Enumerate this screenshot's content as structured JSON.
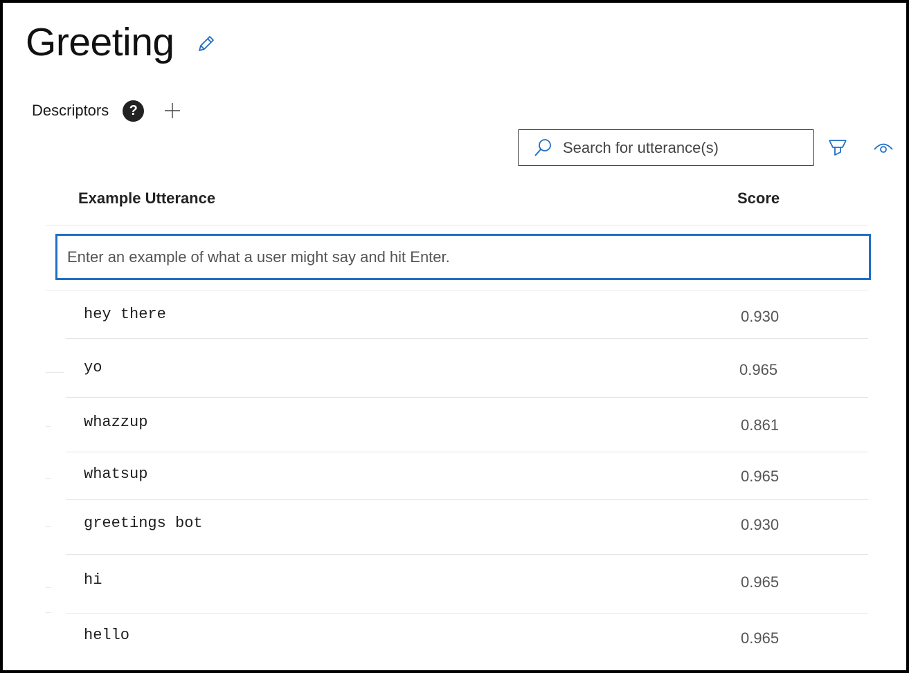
{
  "intent": {
    "title": "Greeting"
  },
  "descriptors": {
    "label": "Descriptors",
    "help_glyph": "?"
  },
  "search": {
    "placeholder": "Search for utterance(s)"
  },
  "table": {
    "columns": {
      "utterance": "Example Utterance",
      "score": "Score"
    },
    "entry_placeholder": "Enter an example of what a user might say and hit Enter.",
    "rows": [
      {
        "utterance": "hey there",
        "score": "0.930"
      },
      {
        "utterance": "yo",
        "score": "0.965"
      },
      {
        "utterance": "whazzup",
        "score": "0.861"
      },
      {
        "utterance": "whatsup",
        "score": "0.965"
      },
      {
        "utterance": "greetings bot",
        "score": "0.930"
      },
      {
        "utterance": "hi",
        "score": "0.965"
      },
      {
        "utterance": "hello",
        "score": "0.965"
      }
    ]
  },
  "icons": {
    "edit": "pencil-icon",
    "help": "question-circle-icon",
    "add": "plus-icon",
    "search": "search-icon",
    "filter": "filter-icon",
    "view": "eye-icon"
  },
  "colors": {
    "accent": "#1f6fc5",
    "frame": "#000000",
    "help_bg": "#222222"
  }
}
